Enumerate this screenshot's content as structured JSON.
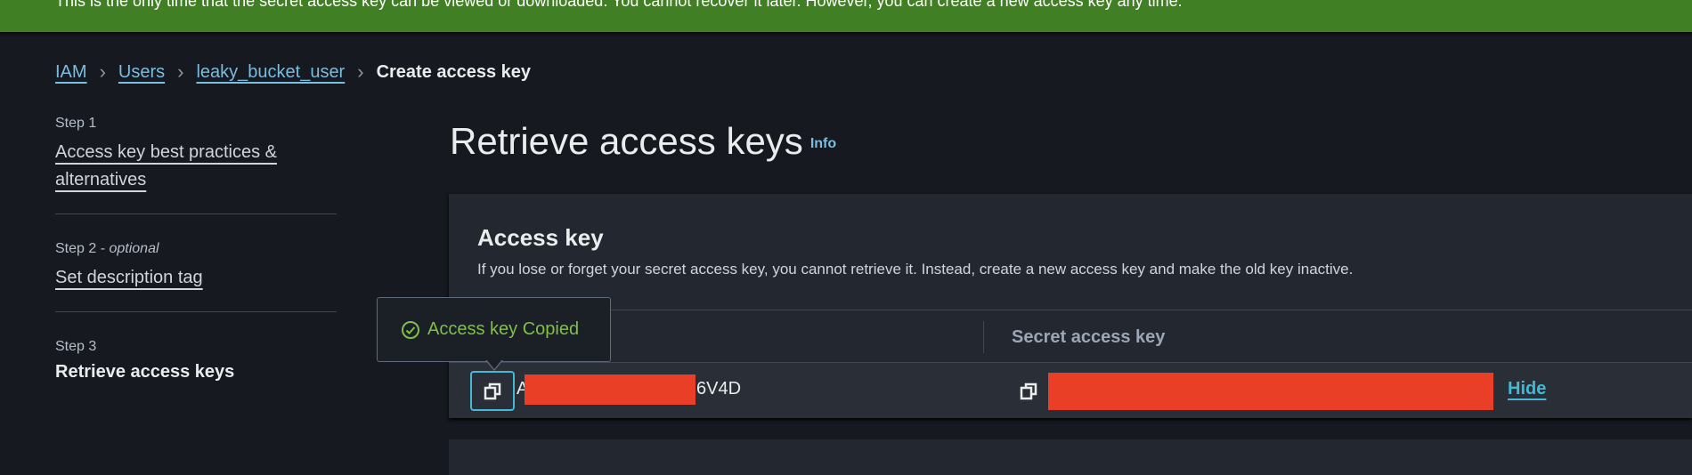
{
  "banner": {
    "text": "This is the only time that the secret access key can be viewed or downloaded. You cannot recover it later. However, you can create a new access key any time."
  },
  "breadcrumb": {
    "items": [
      "IAM",
      "Users",
      "leaky_bucket_user"
    ],
    "current": "Create access key"
  },
  "nav": {
    "steps": [
      {
        "step": "Step 1",
        "label": "Access key best practices & alternatives"
      },
      {
        "step": "Step 2",
        "optional": "optional",
        "label": "Set description tag"
      },
      {
        "step": "Step 3",
        "label": "Retrieve access keys"
      }
    ]
  },
  "page": {
    "title": "Retrieve access keys",
    "info": "Info"
  },
  "panel": {
    "heading": "Access key",
    "description": "If you lose or forget your secret access key, you cannot retrieve it. Instead, create a new access key and make the old key inactive.",
    "col2": "Secret access key",
    "access_key_prefix": "A",
    "access_key_suffix": "6V4D",
    "hide": "Hide"
  },
  "tooltip": {
    "text": "Access key Copied"
  },
  "colors": {
    "banner": "#417f24",
    "link": "#79bde0",
    "success": "#7fbf4a",
    "redaction": "#e93f26"
  }
}
